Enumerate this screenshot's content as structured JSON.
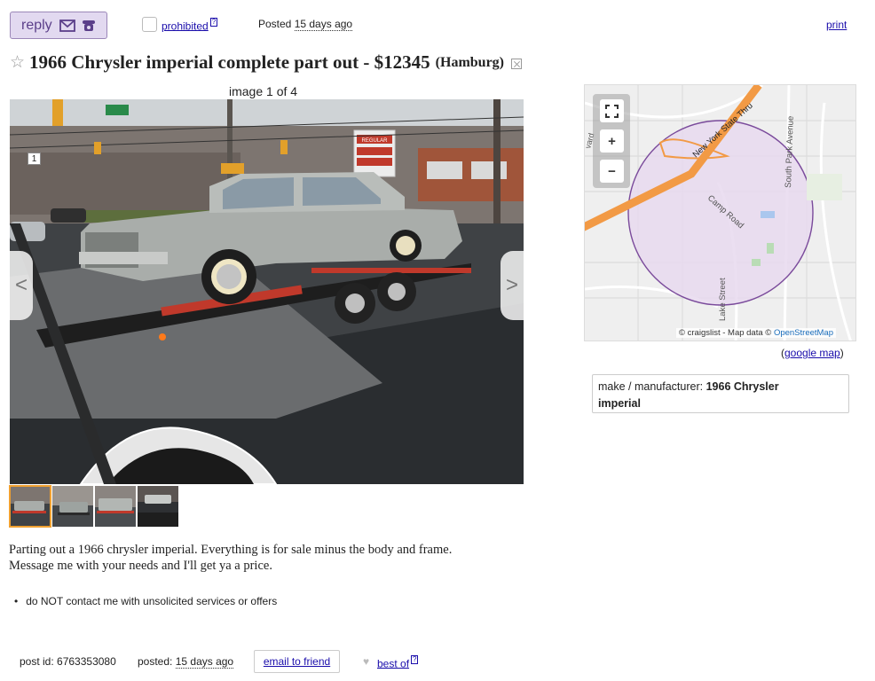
{
  "top_bar": {
    "reply_label": "reply",
    "prohibited_label": "prohibited",
    "prohibited_help": "?",
    "posted_prefix": "Posted",
    "posted_time": "15 days ago",
    "print_label": "print"
  },
  "title": {
    "text": "1966 Chrysler imperial complete part out - $12345",
    "location": "(Hamburg)"
  },
  "gallery": {
    "counter": "image 1 of 4",
    "index_badge": "1",
    "prev_arrow": "<",
    "next_arrow": ">",
    "thumbnail_count": 4,
    "active_thumbnail": 1,
    "photo_sign_text": "REGULAR"
  },
  "description": {
    "line1": "Parting out a 1966 chrysler imperial. Everything is for sale minus the body and frame.",
    "line2": "Message me with your needs and I'll get ya a price."
  },
  "notice": "do NOT contact me with unsolicited services or offers",
  "footer": {
    "post_id_label": "post id: 6763353080",
    "posted_label": "posted:",
    "posted_time": "15 days ago",
    "email_label": "email to friend",
    "best_of_label": "best of",
    "best_of_help": "?"
  },
  "map": {
    "controls": {
      "fullscreen": "⛶",
      "zoom_in": "+",
      "zoom_out": "−"
    },
    "road_labels": [
      "New York State Thru",
      "Camp Road",
      "South Park Avenue",
      "Lake Street",
      "vard"
    ],
    "attribution_prefix": "© craigslist - Map data ©",
    "attribution_link": "OpenStreetMap",
    "google_map_open": "(",
    "google_map_label": "google map",
    "google_map_close": ")"
  },
  "attributes": {
    "label": "make / manufacturer:",
    "value_line1": "1966 Chrysler",
    "value_line2": "imperial"
  },
  "colors": {
    "reply_bg": "#e2d9f0",
    "reply_text": "#5b3f8a",
    "link": "#1a0dab",
    "map_circle_fill": "#e8d9ef",
    "map_circle_stroke": "#7a4a9b",
    "thruway": "#f29a45",
    "active_thumb": "#f0a030"
  }
}
